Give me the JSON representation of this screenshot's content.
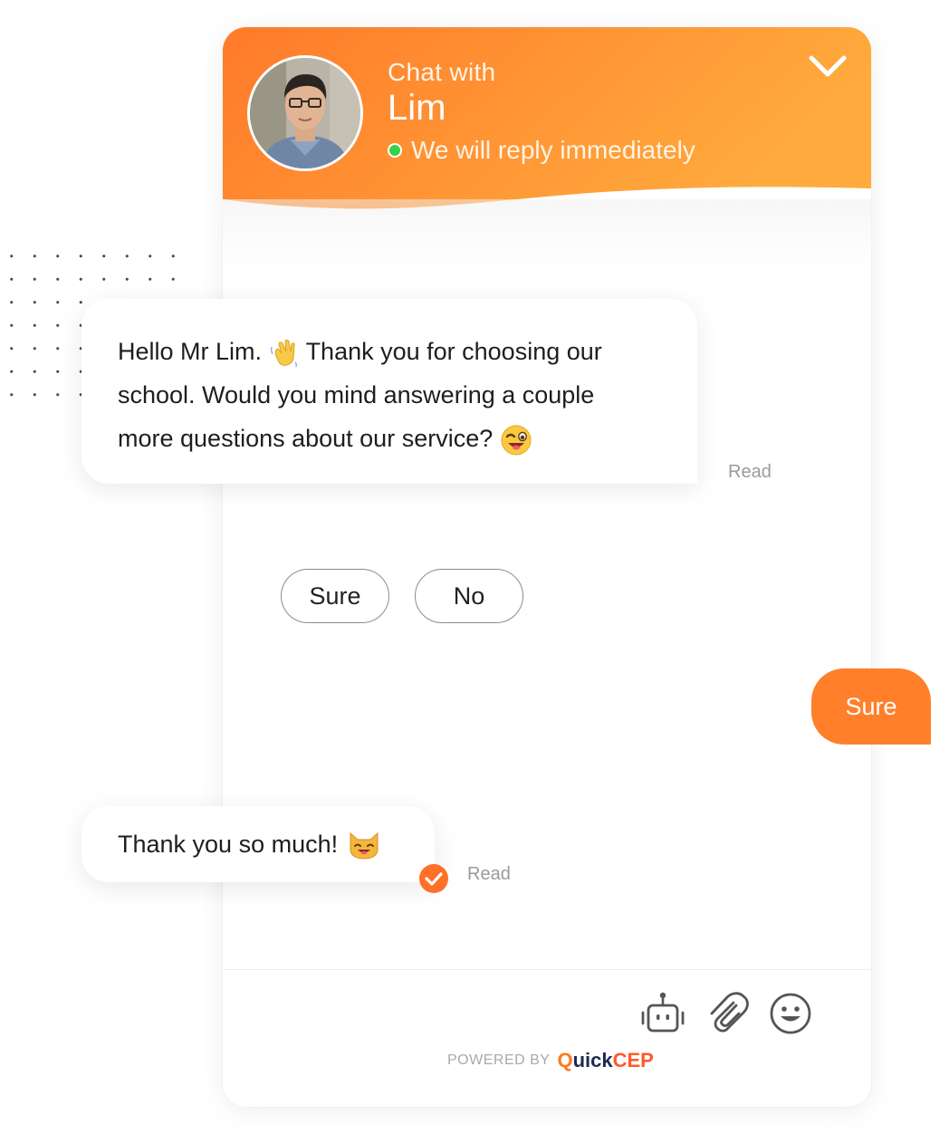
{
  "header": {
    "chat_with": "Chat with",
    "agent_name": "Lim",
    "status": "We will reply immediately",
    "status_color": "#35d14a",
    "gradient_start": "#ff7a2a",
    "gradient_end": "#ffab3d"
  },
  "messages": {
    "welcome_line1": "Hello Mr Lim.",
    "welcome_line1_rest": "Thank you for choosing our",
    "welcome_line2": "school. Would you mind answering a couple",
    "welcome_line3": "more questions about our service?",
    "welcome_read": "Read",
    "quick_replies": [
      "Sure",
      "No"
    ],
    "user_reply": "Sure",
    "thanks": "Thank you so much!",
    "thanks_read": "Read"
  },
  "footer": {
    "icons": [
      "robot-icon",
      "paperclip-icon",
      "smiley-icon"
    ],
    "powered_by": "POWERED BY",
    "brand_q": "Q",
    "brand_uick": "uick",
    "brand_cep": "CEP"
  },
  "colors": {
    "accent": "#ff7f2a",
    "read_text": "#9a9a9a"
  }
}
